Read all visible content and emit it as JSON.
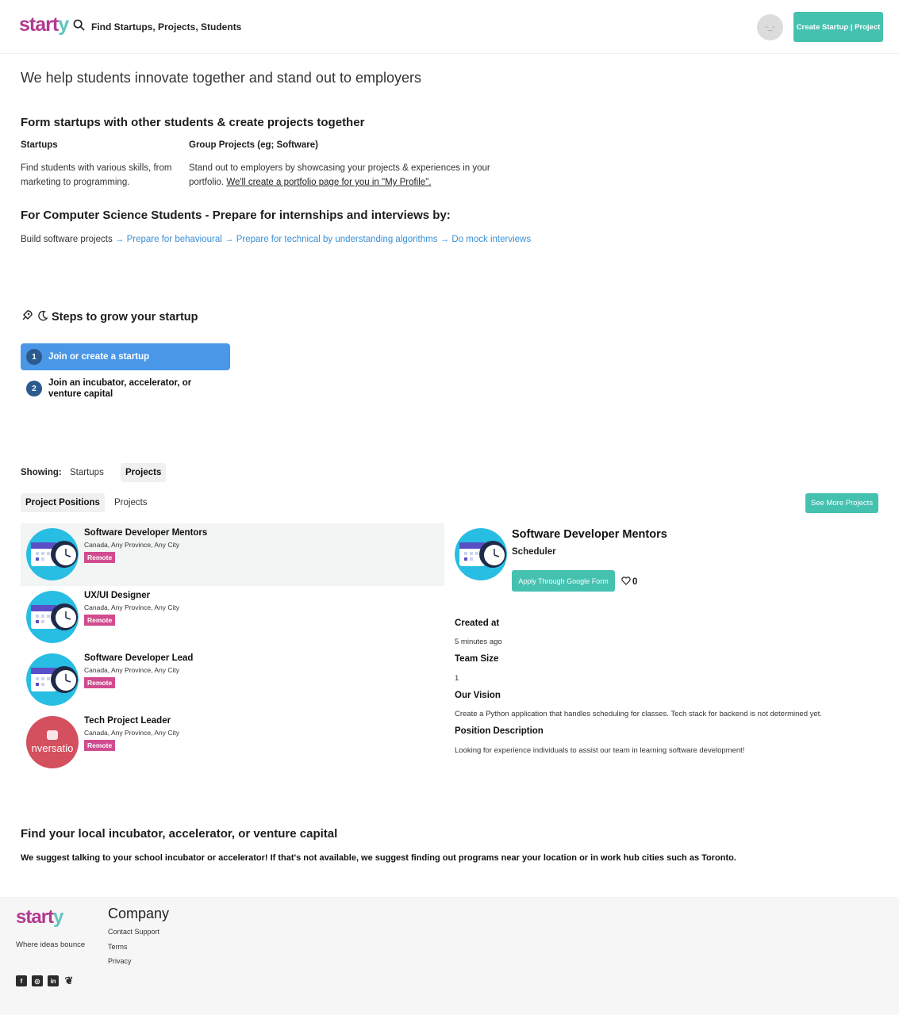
{
  "header": {
    "logo": {
      "part1": "start",
      "part2": "y"
    },
    "search_label": "Find Startups, Projects, Students",
    "avatar_text": "-_-",
    "create_button": "Create Startup | Project"
  },
  "intro": {
    "tagline": "We help students innovate together and stand out to employers",
    "form_heading": "Form startups with other students & create projects together",
    "startups_title": "Startups",
    "startups_text": "Find students with various skills, from marketing to programming.",
    "projects_title": "Group Projects (eg; Software)",
    "projects_text": "Stand out to employers by showcasing your projects & experiences in your portfolio.",
    "projects_link": "We'll create a portfolio page for you in \"My Profile\".",
    "cs_heading": "For Computer Science Students - Prepare for internships and interviews by:",
    "path_start": "Build software projects",
    "path_links": [
      "→ Prepare for behavioural",
      "→ Prepare for technical by understanding algorithms",
      "→ Do mock interviews"
    ]
  },
  "steps": {
    "title": "Steps to grow your startup",
    "items": [
      {
        "num": "1",
        "label": "Join or create a startup"
      },
      {
        "num": "2",
        "label": "Join an incubator, accelerator, or venture capital"
      }
    ]
  },
  "showing": {
    "label": "Showing:",
    "tabs": [
      "Startups",
      "Projects"
    ],
    "subtabs": [
      "Project Positions",
      "Projects"
    ],
    "see_more": "See More Projects"
  },
  "positions": [
    {
      "title": "Software Developer Mentors",
      "location": "Canada, Any Province, Any City",
      "badge": "Remote"
    },
    {
      "title": "UX/UI Designer",
      "location": "Canada, Any Province, Any City",
      "badge": "Remote"
    },
    {
      "title": "Software Developer Lead",
      "location": "Canada, Any Province, Any City",
      "badge": "Remote"
    },
    {
      "title": "Tech Project Leader",
      "location": "Canada, Any Province, Any City",
      "badge": "Remote",
      "thumb_text": "nversatio"
    }
  ],
  "detail": {
    "title": "Software Developer Mentors",
    "subtitle": "Scheduler",
    "apply_button": "Apply Through Google Form",
    "likes": "0",
    "created_label": "Created at",
    "created_value": "5 minutes ago",
    "team_label": "Team Size",
    "team_value": "1",
    "vision_label": "Our Vision",
    "vision_value": "Create a Python application that handles scheduling for classes. Tech stack for backend is not determined yet.",
    "position_label": "Position Description",
    "position_value": "Looking for experience individuals to assist our team in learning software development!"
  },
  "incubator": {
    "heading": "Find your local incubator, accelerator, or venture capital",
    "text": "We suggest talking to your school incubator or accelerator! If that's not available, we suggest finding out programs near your location or in work hub cities such as Toronto."
  },
  "footer": {
    "logo": {
      "part1": "start",
      "part2": "y"
    },
    "tagline": "Where ideas bounce",
    "company": "Company",
    "links": [
      "Contact Support",
      "Terms",
      "Privacy"
    ],
    "social": [
      "facebook-icon",
      "instagram-icon",
      "linkedin-icon",
      "twitter-icon"
    ]
  },
  "colors": {
    "brand_pink": "#b23a8f",
    "brand_teal": "#45c1b0",
    "step_blue": "#4a97e8",
    "badge_pink": "#d14b8f",
    "link_blue": "#3b8fd4"
  }
}
